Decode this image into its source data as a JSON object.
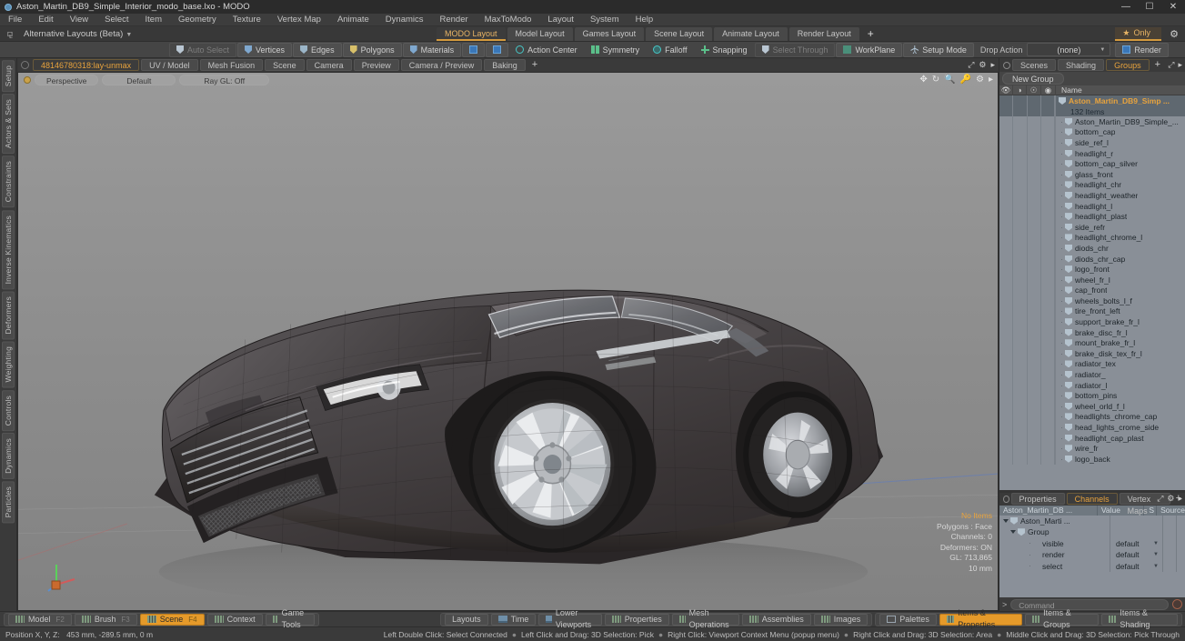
{
  "window": {
    "title": "Aston_Martin_DB9_Simple_Interior_modo_base.lxo - MODO",
    "minimize": "—",
    "maximize": "☐",
    "close": "✕"
  },
  "menubar": {
    "items": [
      "File",
      "Edit",
      "View",
      "Select",
      "Item",
      "Geometry",
      "Texture",
      "Vertex Map",
      "Animate",
      "Dynamics",
      "Render",
      "MaxToModo",
      "Layout",
      "System",
      "Help"
    ]
  },
  "layout_row": {
    "anchor_icon": "pin-icon",
    "alternative_layouts": "Alternative Layouts (Beta)",
    "tabs": [
      {
        "label": "MODO Layout",
        "active": true
      },
      {
        "label": "Model Layout",
        "active": false
      },
      {
        "label": "Games Layout",
        "active": false
      },
      {
        "label": "Scene Layout",
        "active": false
      },
      {
        "label": "Animate Layout",
        "active": false
      },
      {
        "label": "Render Layout",
        "active": false
      }
    ],
    "add_tab": "+",
    "only_button": "Only",
    "only_star": "★",
    "gear": "⚙"
  },
  "main_toolbar": {
    "auto_select": "Auto Select",
    "vertices": "Vertices",
    "edges": "Edges",
    "polygons": "Polygons",
    "materials": "Materials",
    "action_center": "Action Center",
    "symmetry": "Symmetry",
    "falloff": "Falloff",
    "snapping": "Snapping",
    "select_through": "Select Through",
    "workplane": "WorkPlane",
    "setup_mode": "Setup Mode",
    "drop_action_label": "Drop Action",
    "drop_action_value": "(none)",
    "render": "Render"
  },
  "left_vertical_tabs": [
    "Setup",
    "Actors & Sets",
    "Constraints",
    "Inverse Kinematics",
    "Deformers",
    "Weighting",
    "Controls",
    "Dynamics",
    "Particles"
  ],
  "viewport_tabs": {
    "items": [
      {
        "label": "48146780318:lay-unmax",
        "active": true
      },
      {
        "label": "UV / Model",
        "active": false
      },
      {
        "label": "Mesh Fusion",
        "active": false
      },
      {
        "label": "Scene",
        "active": false
      },
      {
        "label": "Camera",
        "active": false
      },
      {
        "label": "Preview",
        "active": false
      },
      {
        "label": "Camera / Preview",
        "active": false
      },
      {
        "label": "Baking",
        "active": false
      }
    ],
    "add_tab": "+"
  },
  "viewport": {
    "view_mode": "Perspective",
    "shading": "Default",
    "raygl": "Ray GL: Off",
    "stats": {
      "selection": "No Items",
      "polygons": "Polygons : Face",
      "channels": "Channels: 0",
      "deformers": "Deformers: ON",
      "gl": "GL: 713,865",
      "grid": "10 mm"
    },
    "icons": [
      "pan-icon",
      "rotate-icon",
      "zoom-icon",
      "key-icon",
      "gear-icon",
      "chevron-right-icon"
    ]
  },
  "right_panel": {
    "tabs": [
      {
        "label": "Scenes",
        "active": false
      },
      {
        "label": "Shading",
        "active": false
      },
      {
        "label": "Groups",
        "active": true
      }
    ],
    "add_tab": "+",
    "new_group_button": "New Group",
    "list_header": {
      "eye": "visibility-icon",
      "render": "render-icon",
      "lock": "lock-icon",
      "select": "select-icon",
      "name": "Name"
    },
    "selected_group": {
      "label": "Aston_Martin_DB9_Simp ...",
      "item_count": "132 Items"
    },
    "items": [
      "Aston_Martin_DB9_Simple_...",
      "bottom_cap",
      "side_ref_l",
      "headlight_r",
      "bottom_cap_silver",
      "glass_front",
      "headlight_chr",
      "headlight_weather",
      "headlight_l",
      "headlight_plast",
      "side_refr",
      "headlight_chrome_l",
      "diods_chr",
      "diods_chr_cap",
      "logo_front",
      "wheel_fr_l",
      "cap_front",
      "wheels_bolts_l_f",
      "tire_front_left",
      "support_brake_fr_l",
      "brake_disc_fr_l",
      "mount_brake_fr_l",
      "brake_disk_tex_fr_l",
      "radiator_tex",
      "radiator_",
      "radiator_l",
      "bottom_pins",
      "wheel_orld_f_l",
      "headlights_chrome_cap",
      "head_lights_crome_side",
      "headlight_cap_plast",
      "wire_fr",
      "logo_back"
    ]
  },
  "properties_panel": {
    "tabs": [
      {
        "label": "Properties",
        "active": false
      },
      {
        "label": "Channels",
        "active": true
      },
      {
        "label": "Vertex Maps",
        "active": false
      }
    ],
    "add_tab": "+",
    "columns": [
      "Aston_Martin_DB ...",
      "Value",
      "S",
      "Source"
    ],
    "rows": [
      {
        "name": "Aston_Marti ...",
        "value": "",
        "indent": 0,
        "type": "root"
      },
      {
        "name": "Group",
        "value": "",
        "indent": 1,
        "type": "group"
      },
      {
        "name": "visible",
        "value": "default",
        "indent": 2,
        "type": "channel"
      },
      {
        "name": "render",
        "value": "default",
        "indent": 2,
        "type": "channel"
      },
      {
        "name": "select",
        "value": "default",
        "indent": 2,
        "type": "channel"
      }
    ],
    "command_placeholder": "Command",
    "command_prompt": ">"
  },
  "bottom_toolbar": {
    "left_groups": [
      {
        "label": "Model",
        "fkey": "F2",
        "active": false
      },
      {
        "label": "Brush",
        "fkey": "F3",
        "active": false
      },
      {
        "label": "Scene",
        "fkey": "F4",
        "active": true
      },
      {
        "label": "Context",
        "fkey": "",
        "active": false
      },
      {
        "label": "Game Tools",
        "fkey": "",
        "active": false
      }
    ],
    "center_groups": [
      {
        "label": "Layouts",
        "active": false
      },
      {
        "label": "Time",
        "active": false
      },
      {
        "label": "Lower Viewports",
        "active": false
      },
      {
        "label": "Properties",
        "active": false
      },
      {
        "label": "Mesh Operations",
        "active": false
      },
      {
        "label": "Assemblies",
        "active": false
      },
      {
        "label": "Images",
        "active": false
      }
    ],
    "right_groups": [
      {
        "label": "Palettes",
        "active": false
      },
      {
        "label": "Items & Properties",
        "active": true
      },
      {
        "label": "Items & Groups",
        "active": false
      },
      {
        "label": "Items & Shading",
        "active": false
      }
    ]
  },
  "status_bar": {
    "position_label": "Position X, Y, Z:",
    "position_value": "453 mm, -289.5 mm, 0 m",
    "hints": [
      "Left Double Click: Select Connected",
      "Left Click and Drag: 3D Selection: Pick",
      "Right Click: Viewport Context Menu (popup menu)",
      "Right Click and Drag: 3D Selection: Area",
      "Middle Click and Drag: 3D Selection: Pick Through"
    ],
    "separator": "●"
  },
  "colors": {
    "accent_orange": "#e8a33d",
    "active_tab_bg": "#e59a2a",
    "panel_bg": "#3c3c3c",
    "viewport_bg": "#8b8b8b",
    "list_bg": "#898f97"
  }
}
